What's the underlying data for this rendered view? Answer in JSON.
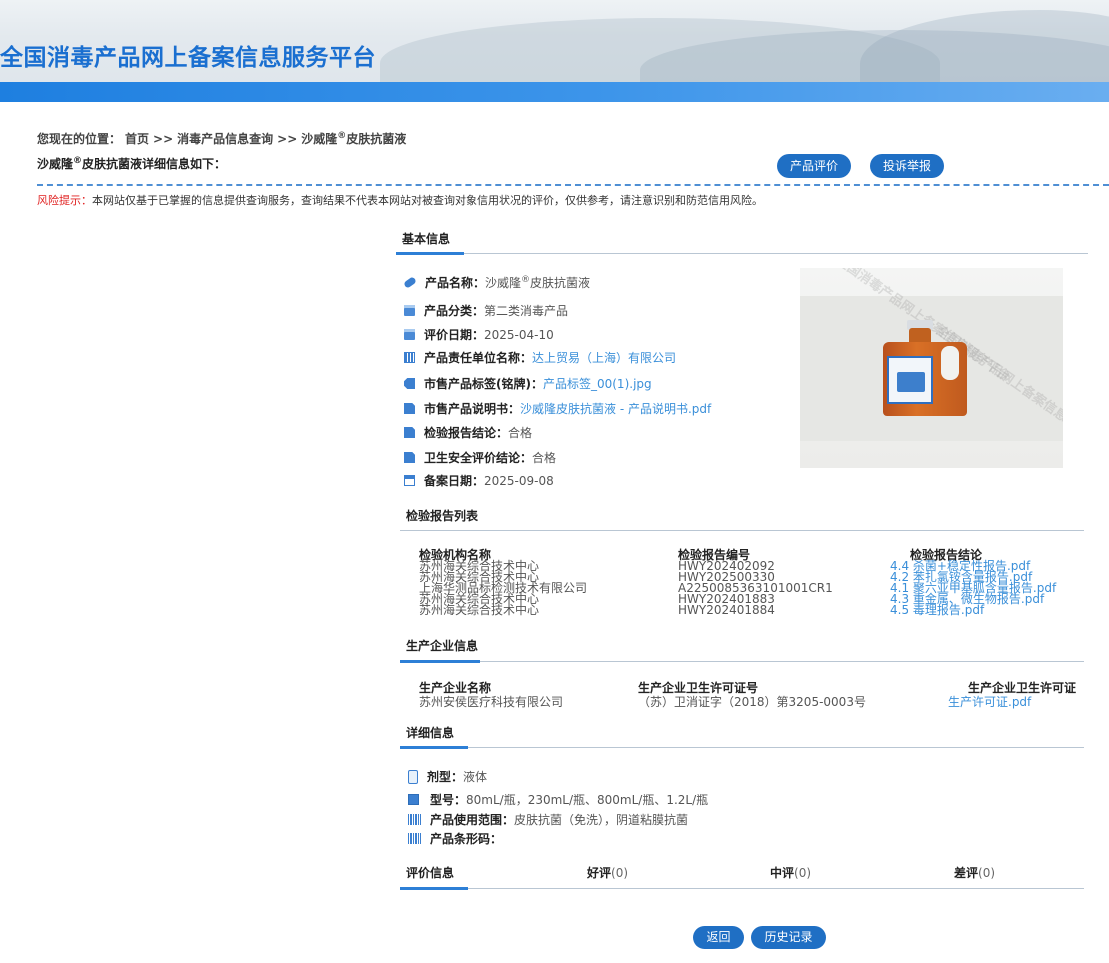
{
  "site": {
    "title": "全国消毒产品网上备案信息服务平台"
  },
  "breadcrumb": {
    "prefix": "您现在的位置：",
    "items": [
      "首页",
      ">>",
      "消毒产品信息查询",
      ">>",
      "沙威隆"
    ],
    "sup": "®",
    "tail": "皮肤抗菌液"
  },
  "detail_title": {
    "pre": "沙威隆",
    "sup": "®",
    "post": "皮肤抗菌液详细信息如下："
  },
  "actions": {
    "rate": "产品评价",
    "report": "投诉举报"
  },
  "risk": {
    "label": "风险提示：",
    "text": "本网站仅基于已掌握的信息提供查询服务，查询结果不代表本网站对被查询对象信用状况的评价，仅供参考，请注意识别和防范信用风险。"
  },
  "basic": {
    "title": "基本信息",
    "product_name": {
      "key": "产品名称：",
      "pre": "沙威隆",
      "sup": "®",
      "post": "皮肤抗菌液"
    },
    "category": {
      "key": "产品分类：",
      "value": "第二类消毒产品"
    },
    "eval_date": {
      "key": "评价日期：",
      "value": "2025-04-10"
    },
    "owner": {
      "key": "产品责任单位名称：",
      "value": "达上贸易（上海）有限公司"
    },
    "tag": {
      "key": "市售产品标签(铭牌)：",
      "value": "产品标签_00(1).jpg"
    },
    "manual": {
      "key": "市售产品说明书：",
      "value": "沙威隆皮肤抗菌液 - 产品说明书.pdf"
    },
    "test_conclusion": {
      "key": "检验报告结论：",
      "value": "合格"
    },
    "safety_conclusion": {
      "key": "卫生安全评价结论：",
      "value": "合格"
    },
    "record_date": {
      "key": "备案日期：",
      "value": "2025-09-08"
    },
    "watermark": "全国消毒产品网上备案信息服务平台"
  },
  "reports": {
    "title": "检验报告列表",
    "headers": [
      "检验机构名称",
      "检验报告编号",
      "检验报告结论"
    ],
    "rows": [
      [
        "苏州海关综合技术中心",
        "HWY202402092",
        "4.4 杀菌+稳定性报告.pdf"
      ],
      [
        "苏州海关综合技术中心",
        "HWY202500330",
        "4.2 苯扎氯铵含量报告.pdf"
      ],
      [
        "上海华测品标检测技术有限公司",
        "A2250085363101001CR1",
        "4.1 聚六亚甲基胍含量报告.pdf"
      ],
      [
        "苏州海关综合技术中心",
        "HWY202401883",
        "4.3 重金属、微生物报告.pdf"
      ],
      [
        "苏州海关综合技术中心",
        "HWY202401884",
        "4.5 毒理报告.pdf"
      ]
    ]
  },
  "producer": {
    "title": "生产企业信息",
    "headers": [
      "生产企业名称",
      "生产企业卫生许可证号",
      "生产企业卫生许可证"
    ],
    "row": [
      "苏州安侯医疗科技有限公司",
      "（苏）卫消证字（2018）第3205-0003号",
      "生产许可证.pdf"
    ]
  },
  "detail": {
    "title": "详细信息",
    "form": {
      "key": "剂型：",
      "value": "液体"
    },
    "model": {
      "key": "型号：",
      "value": "80mL/瓶，230mL/瓶、800mL/瓶、1.2L/瓶"
    },
    "usage": {
      "key": "产品使用范围：",
      "value": "皮肤抗菌（免洗），阴道粘膜抗菌"
    },
    "barcode": {
      "key": "产品条形码：",
      "value": ""
    }
  },
  "ratings": {
    "title": "评价信息",
    "good": {
      "label": "好评",
      "count": "(0)"
    },
    "mid": {
      "label": "中评",
      "count": "(0)"
    },
    "bad": {
      "label": "差评",
      "count": "(0)"
    }
  },
  "footer": {
    "back": "返回",
    "history": "历史记录"
  }
}
